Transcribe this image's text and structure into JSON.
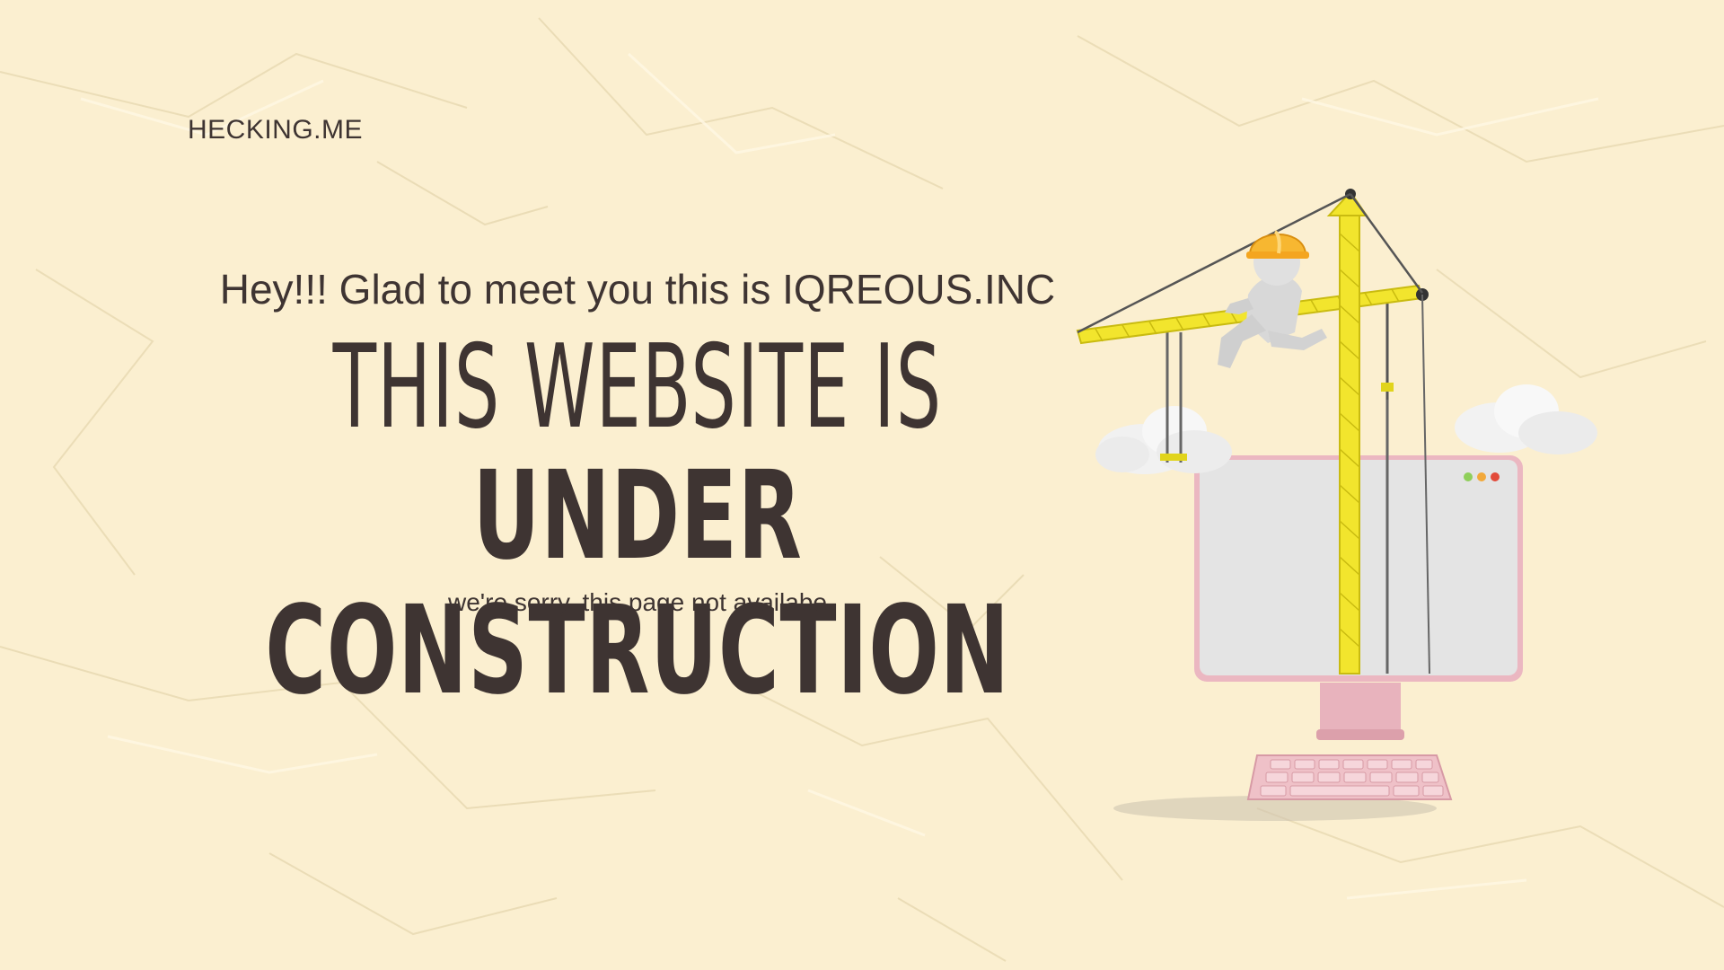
{
  "brand": "HECKING.ME",
  "intro": "Hey!!! Glad to meet you this is IQREOUS.INC",
  "headline_line1": "THIS WEBSITE IS",
  "headline_line2": "UNDER CONSTRUCTION",
  "subtext": "we're sorry, this page not availabe",
  "illustration": {
    "icon": "construction-crane-computer-icon",
    "elements": [
      "crane-icon",
      "worker-hardhat-icon",
      "cloud-icon",
      "monitor-icon",
      "keyboard-icon"
    ]
  },
  "colors": {
    "background": "#fbefd0",
    "text": "#3e3432",
    "crane": "#f1e12a",
    "monitor_frame": "#e8b7c0",
    "screen": "#e4e4e4",
    "hardhat": "#f7b731"
  }
}
